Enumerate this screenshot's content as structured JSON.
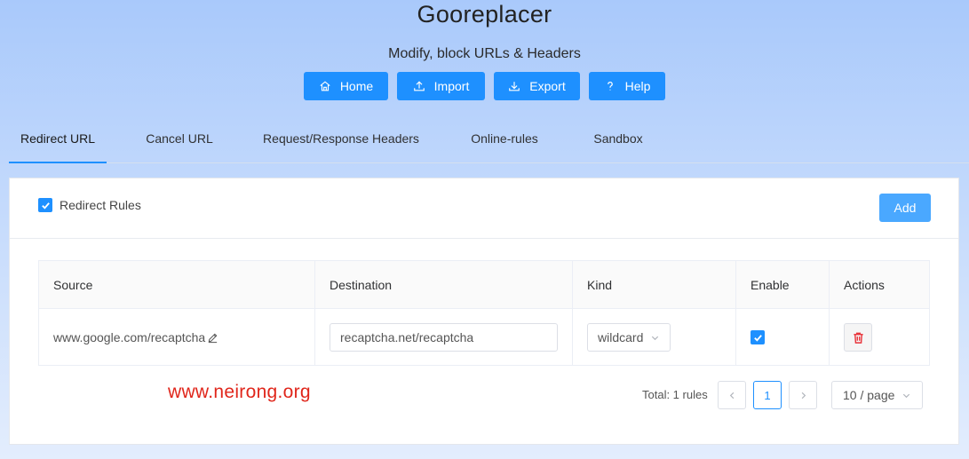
{
  "app": {
    "title": "Gooreplacer",
    "subtitle": "Modify, block URLs & Headers"
  },
  "top_buttons": [
    {
      "label": "Home",
      "icon": "home-icon"
    },
    {
      "label": "Import",
      "icon": "upload-icon"
    },
    {
      "label": "Export",
      "icon": "download-icon"
    },
    {
      "label": "Help",
      "icon": "question-icon"
    }
  ],
  "tabs": [
    {
      "label": "Redirect URL",
      "active": true
    },
    {
      "label": "Cancel URL",
      "active": false
    },
    {
      "label": "Request/Response Headers",
      "active": false
    },
    {
      "label": "Online-rules",
      "active": false
    },
    {
      "label": "Sandbox",
      "active": false
    }
  ],
  "panel": {
    "rules_label": "Redirect Rules",
    "rules_checked": true,
    "add_label": "Add"
  },
  "table": {
    "columns": [
      "Source",
      "Destination",
      "Kind",
      "Enable",
      "Actions"
    ],
    "rows": [
      {
        "source": "www.google.com/recaptcha",
        "destination": "recaptcha.net/recaptcha",
        "kind": "wildcard",
        "enabled": true
      }
    ]
  },
  "watermark": "www.neirong.org",
  "pagination": {
    "total": "Total: 1 rules",
    "current_page": "1",
    "page_size": "10 / page"
  },
  "colors": {
    "accent": "#1e90ff",
    "add_button": "#4aa8ff",
    "delete_icon": "#e8333a",
    "watermark": "#e0261b"
  }
}
